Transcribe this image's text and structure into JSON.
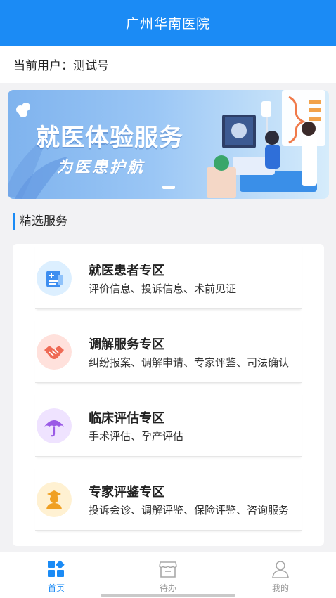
{
  "header": {
    "title": "广州华南医院"
  },
  "user": {
    "label": "当前用户：测试号"
  },
  "banner": {
    "title": "就医体验服务",
    "subtitle": "为医患护航"
  },
  "section": {
    "title": "精选服务"
  },
  "services": [
    {
      "name": "就医患者专区",
      "desc": "评价信息、投诉信息、术前见证",
      "icon": "patient-card-icon",
      "color": "#dcefff"
    },
    {
      "name": "调解服务专区",
      "desc": "纠纷报案、调解申请、专家评鉴、司法确认",
      "icon": "handshake-icon",
      "color": "#ffe1dc"
    },
    {
      "name": "临床评估专区",
      "desc": "手术评估、孕产评估",
      "icon": "umbrella-icon",
      "color": "#efe3ff"
    },
    {
      "name": "专家评鉴专区",
      "desc": "投诉会诊、调解评鉴、保险评鉴、咨询服务",
      "icon": "expert-icon",
      "color": "#fff1d2"
    }
  ],
  "tabbar": {
    "items": [
      {
        "label": "首页",
        "icon": "home-grid-icon",
        "active": true
      },
      {
        "label": "待办",
        "icon": "store-icon",
        "active": false
      },
      {
        "label": "我的",
        "icon": "person-icon",
        "active": false
      }
    ],
    "active_color": "#1b8bf5",
    "inactive_color": "#999999"
  }
}
